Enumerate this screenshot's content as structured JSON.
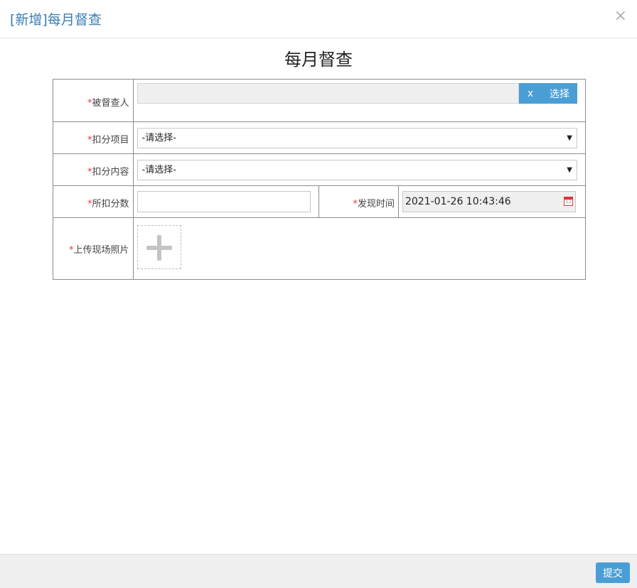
{
  "dialog": {
    "header_title": "[新增]每月督查",
    "close_glyph": "×",
    "form_title": "每月督查"
  },
  "form": {
    "required_mark": "*",
    "person": {
      "label": "被督查人",
      "value": "",
      "clear_label": "x",
      "choose_label": "选择"
    },
    "deduct_item": {
      "label": "扣分项目",
      "selected": "-请选择-"
    },
    "deduct_content": {
      "label": "扣分内容",
      "selected": "-请选择-"
    },
    "score": {
      "label": "所扣分数",
      "value": ""
    },
    "found_time": {
      "label": "发现时间",
      "value": "2021-01-26 10:43:46",
      "icon": "calendar-icon"
    },
    "photo": {
      "label": "上传现场照片",
      "icon": "plus-icon"
    }
  },
  "footer": {
    "submit_label": "提交"
  },
  "colors": {
    "accent": "#4a9ed6",
    "required": "#e03b3b",
    "title": "#3a7db5"
  }
}
